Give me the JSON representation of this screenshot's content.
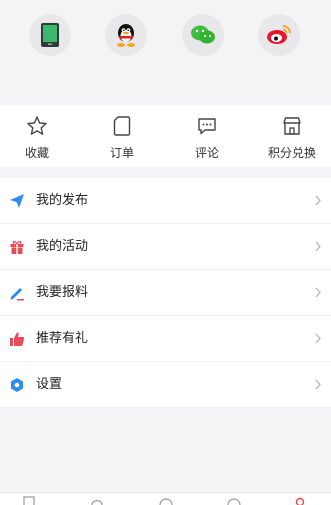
{
  "login_methods": [
    {
      "name": "phone",
      "icon": "phone-icon"
    },
    {
      "name": "qq",
      "icon": "qq-penguin-icon"
    },
    {
      "name": "wechat",
      "icon": "wechat-icon"
    },
    {
      "name": "weibo",
      "icon": "weibo-icon"
    }
  ],
  "quick_actions": [
    {
      "label": "收藏",
      "icon": "star-icon"
    },
    {
      "label": "订单",
      "icon": "order-icon"
    },
    {
      "label": "评论",
      "icon": "comment-icon"
    },
    {
      "label": "积分兑换",
      "icon": "store-icon"
    }
  ],
  "menu": [
    {
      "label": "我的发布",
      "icon": "send-icon",
      "color": "#2d8cf0"
    },
    {
      "label": "我的活动",
      "icon": "gift-icon",
      "color": "#e84b5a"
    },
    {
      "label": "我要报料",
      "icon": "pen-icon",
      "color": "#2d8cf0"
    },
    {
      "label": "推荐有礼",
      "icon": "thumbs-up-icon",
      "color": "#e84b5a"
    },
    {
      "label": "设置",
      "icon": "settings-icon",
      "color": "#2d8cf0"
    }
  ],
  "colors": {
    "accent_blue": "#2d8cf0",
    "accent_red": "#e84b5a",
    "wechat_green": "#3fbf3f",
    "weibo_red": "#e6162d"
  }
}
